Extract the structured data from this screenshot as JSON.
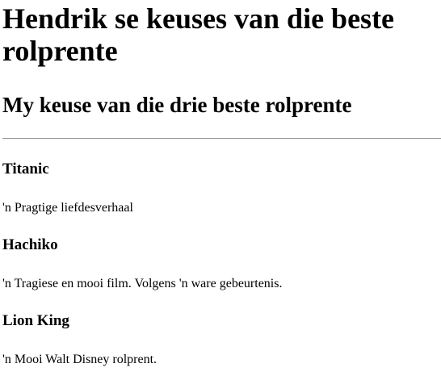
{
  "page": {
    "title": "Hendrik se keuses van die beste rolprente",
    "subtitle": "My keuse van die drie beste rolprente"
  },
  "films": [
    {
      "title": "Titanic",
      "description": "'n Pragtige liefdesverhaal"
    },
    {
      "title": "Hachiko",
      "description": "'n Tragiese en mooi film. Volgens 'n ware gebeurtenis."
    },
    {
      "title": "Lion King",
      "description": "'n Mooi Walt Disney rolprent."
    }
  ]
}
